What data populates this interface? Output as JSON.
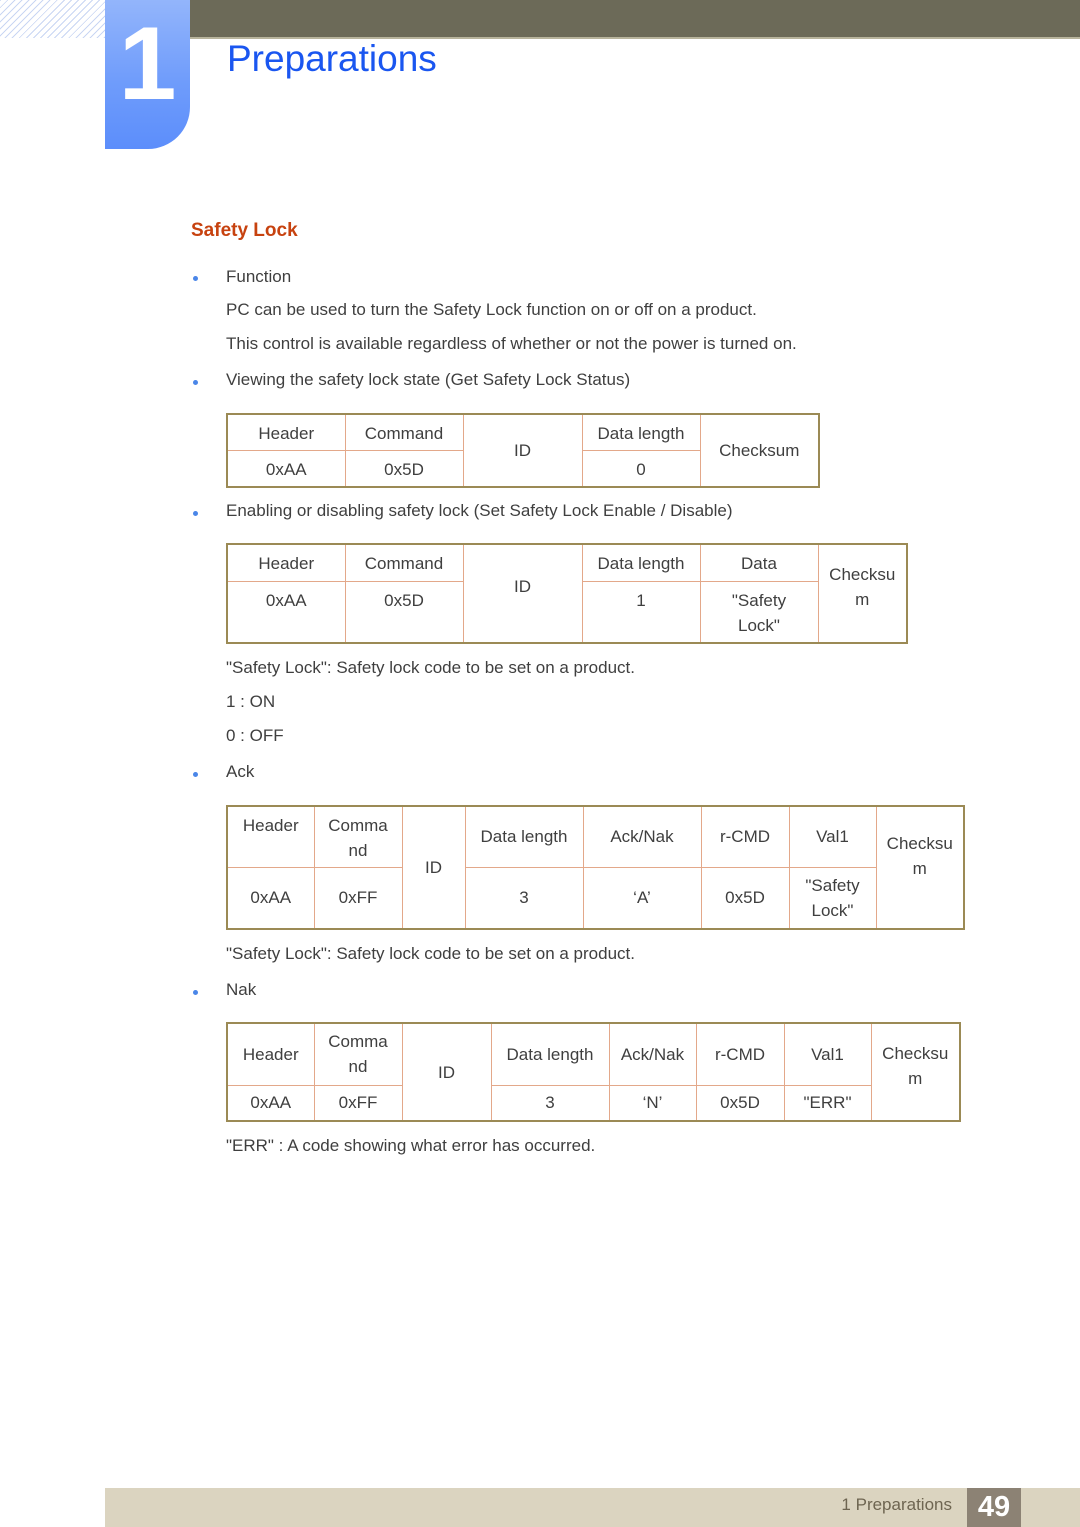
{
  "header": {
    "chapter_number": "1",
    "chapter_title": "Preparations"
  },
  "section": {
    "title": "Safety Lock"
  },
  "bullets": {
    "function": "Function",
    "function_desc_1": "PC can be used to turn the Safety Lock function on or off on a product.",
    "function_desc_2": "This control is available regardless of whether or not the power is turned on.",
    "get_status": "Viewing the safety lock state (Get Safety Lock Status)",
    "set_status": "Enabling or disabling safety lock (Set Safety Lock Enable / Disable)",
    "ack": "Ack",
    "nak": "Nak"
  },
  "notes": {
    "set_safety_lock": "\"Safety Lock\": Safety lock code to be set on a product.",
    "on": "1 : ON",
    "off": "0 : OFF",
    "ack_safety_lock": "\"Safety Lock\": Safety lock code to be set on a product.",
    "err": "\"ERR\" : A code showing what error has occurred."
  },
  "tables": {
    "get": {
      "headers": [
        "Header",
        "Command",
        "ID",
        "Data length",
        "Checksum"
      ],
      "values": [
        "0xAA",
        "0x5D",
        "0"
      ]
    },
    "set": {
      "headers": [
        "Header",
        "Command",
        "ID",
        "Data length",
        "Data",
        "Checksu\nm"
      ],
      "values": [
        "0xAA",
        "0x5D",
        "1",
        "\"Safety\nLock\""
      ]
    },
    "ack": {
      "headers": [
        "Header",
        "Comma\nnd",
        "ID",
        "Data length",
        "Ack/Nak",
        "r-CMD",
        "Val1",
        "Checksu\nm"
      ],
      "values": [
        "0xAA",
        "0xFF",
        "3",
        "‘A’",
        "0x5D",
        "\"Safety\nLock\""
      ]
    },
    "nak": {
      "headers": [
        "Header",
        "Comma\nnd",
        "ID",
        "Data length",
        "Ack/Nak",
        "r-CMD",
        "Val1",
        "Checksu\nm"
      ],
      "values": [
        "0xAA",
        "0xFF",
        "3",
        "‘N’",
        "0x5D",
        "\"ERR\""
      ]
    }
  },
  "footer": {
    "label": "1 Preparations",
    "page_number": "49"
  },
  "colors": {
    "chapter_title": "#1a56f0",
    "section_title": "#c7420f",
    "bullet": "#4a86e8",
    "table_outer_border": "#9b8a55",
    "table_inner_border": "#e3a88a",
    "top_bar": "#6c6a58",
    "footer_bar": "#dbd4c0",
    "page_badge": "#8c8274"
  }
}
